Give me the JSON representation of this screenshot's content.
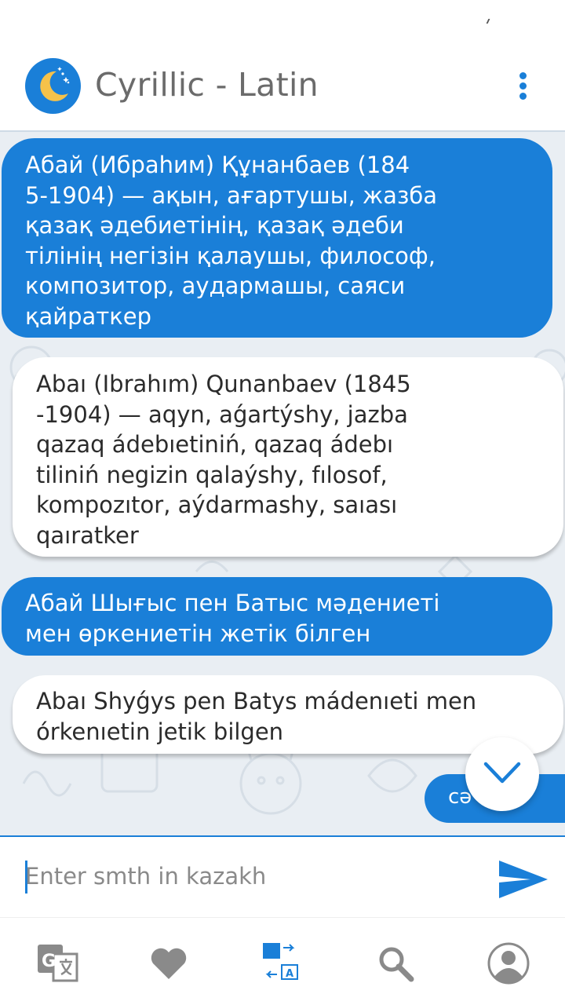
{
  "app": {
    "title": "Cyrillic - Latin",
    "logo_icon": "crescent-moon-icon",
    "menu_icon": "more-vertical-icon"
  },
  "colors": {
    "accent": "#1a7fd8",
    "chat_background": "#e9eef3",
    "bubble_light": "#ffffff",
    "title_gray": "#6b6b6b"
  },
  "messages": [
    {
      "type": "cyrillic",
      "text": "Абай (Ибраһим) Құнанбаев (184\n5-1904) — ақын, ағартушы, жазба\nқазақ әдебиетінің, қазақ әдеби\nтілінің негізін қалаушы, философ,\nкомпозитор, аудармашы, саяси\nқайраткер"
    },
    {
      "type": "latin",
      "text": "Abaı (Ibrahım) Qunanbaev (1845\n-1904) — aqyn, aǵartýshy, jazba\nqazaq ádebıetiniń, qazaq ádebı\ntiliniń negizin qalaýshy, fılosof,\nkompozıtor, aýdarmashy, saıası\nqaıratker"
    },
    {
      "type": "cyrillic",
      "text": "Абай Шығыс пен Батыс мәдениеті\nмен өркениетін жетік білген"
    },
    {
      "type": "latin",
      "text": "Abaı Shyǵys pen Batys mádenıeti men\nórkenıetin jetik bilgen"
    },
    {
      "type": "cyrillic-partial",
      "text": "сә"
    }
  ],
  "scroll_down_icon": "chevron-down-icon",
  "input": {
    "placeholder": "Enter smth in kazakh",
    "value": "",
    "send_icon": "send-icon"
  },
  "bottom_nav": [
    {
      "name": "translate",
      "icon": "translate-icon",
      "active": false
    },
    {
      "name": "favorites",
      "icon": "heart-icon",
      "active": false
    },
    {
      "name": "transliterate",
      "icon": "transliterate-icon",
      "active": true
    },
    {
      "name": "search",
      "icon": "search-icon",
      "active": false
    },
    {
      "name": "profile",
      "icon": "profile-icon",
      "active": false
    }
  ]
}
